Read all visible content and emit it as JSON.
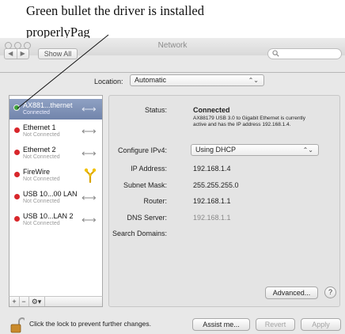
{
  "annotation": {
    "line1": "Green bullet the driver is installed",
    "line2": "properlyPag"
  },
  "window": {
    "title": "Network",
    "show_all": "Show All",
    "nav_back": "◀",
    "nav_forward": "▶",
    "search_icon": "search-icon",
    "search_placeholder": ""
  },
  "location": {
    "label": "Location:",
    "value": "Automatic"
  },
  "services": [
    {
      "name": "AX881...thernet",
      "status": "Connected",
      "indicator": "green",
      "icon": "ethernet-arrows-icon"
    },
    {
      "name": "Ethernet 1",
      "status": "Not Connected",
      "indicator": "red",
      "icon": "ethernet-arrows-icon"
    },
    {
      "name": "Ethernet 2",
      "status": "Not Connected",
      "indicator": "red",
      "icon": "ethernet-arrows-icon"
    },
    {
      "name": "FireWire",
      "status": "Not Connected",
      "indicator": "red",
      "icon": "firewire-icon"
    },
    {
      "name": "USB 10...00 LAN",
      "status": "Not Connected",
      "indicator": "red",
      "icon": "ethernet-arrows-icon"
    },
    {
      "name": "USB 10...LAN 2",
      "status": "Not Connected",
      "indicator": "red",
      "icon": "ethernet-arrows-icon"
    }
  ],
  "sidebar_footer": {
    "add": "+",
    "remove": "−",
    "action": "⚙▾"
  },
  "details": {
    "status_label": "Status:",
    "status_value": "Connected",
    "status_description": "AX88179 USB 3.0 to Gigabit Ethernet is currently active and has the IP address 192.168.1.4.",
    "configure_label": "Configure IPv4:",
    "configure_value": "Using DHCP",
    "ip_label": "IP Address:",
    "ip_value": "192.168.1.4",
    "subnet_label": "Subnet Mask:",
    "subnet_value": "255.255.255.0",
    "router_label": "Router:",
    "router_value": "192.168.1.1",
    "dns_label": "DNS Server:",
    "dns_value": "192.168.1.1",
    "search_domains_label": "Search Domains:"
  },
  "buttons": {
    "advanced": "Advanced...",
    "help": "?",
    "assist": "Assist me...",
    "revert": "Revert",
    "apply": "Apply"
  },
  "lock": {
    "text": "Click the lock to prevent further changes."
  },
  "colors": {
    "connected": "#3ea33a",
    "not_connected": "#d8262b",
    "selection": "#7f92b8"
  }
}
